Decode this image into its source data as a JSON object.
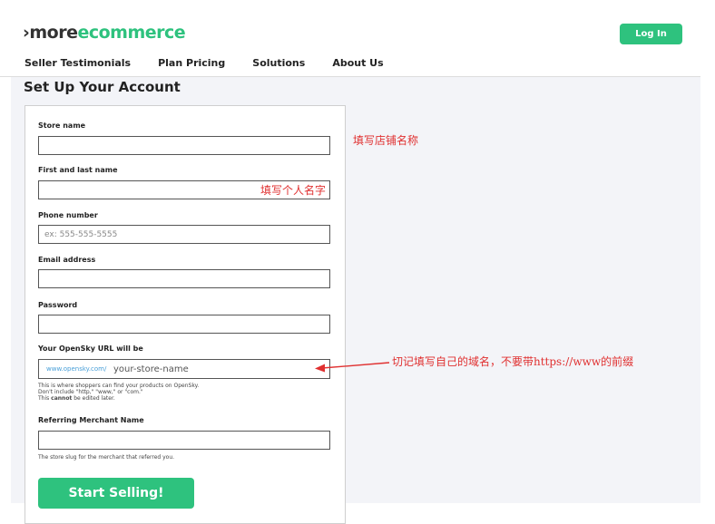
{
  "header": {
    "logo_prefix": "›",
    "logo_more": "more",
    "logo_ecommerce": "ecommerce",
    "login_label": "Log In"
  },
  "nav": {
    "items": [
      "Seller Testimonials",
      "Plan Pricing",
      "Solutions",
      "About Us"
    ]
  },
  "page_title": "Set Up Your Account",
  "form": {
    "store_name_label": "Store name",
    "name_label": "First and last name",
    "phone_label": "Phone number",
    "phone_placeholder": "ex: 555-555-5555",
    "email_label": "Email address",
    "password_label": "Password",
    "url_label": "Your OpenSky URL will be",
    "url_prefix": "www.opensky.com/",
    "url_placeholder": "your-store-name",
    "url_help_1": "This is where shoppers can find your products on OpenSky.",
    "url_help_2": "Don't include \"http,\" \"www,\" or \"com.\"",
    "url_help_3_prefix": "This ",
    "url_help_3_bold": "cannot",
    "url_help_3_suffix": " be edited later.",
    "referring_label": "Referring Merchant Name",
    "referring_help": "The store slug for the merchant that referred you.",
    "submit_label": "Start Selling!"
  },
  "annotations": {
    "store_note": "填写店铺名称",
    "name_note": "填写个人名字",
    "url_note": "切记填写自己的域名，不要带https://www的前缀"
  },
  "colors": {
    "brand_green": "#2ec27e",
    "annotation_red": "#e03030",
    "link_blue": "#4aa0d8"
  }
}
